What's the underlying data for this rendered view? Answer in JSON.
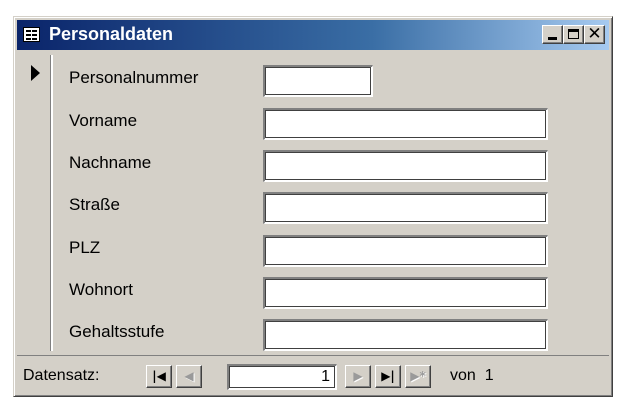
{
  "window": {
    "title": "Personaldaten",
    "close_glyph": "✕"
  },
  "fields": [
    {
      "label": "Personalnummer",
      "value": ""
    },
    {
      "label": "Vorname",
      "value": ""
    },
    {
      "label": "Nachname",
      "value": ""
    },
    {
      "label": "Straße",
      "value": ""
    },
    {
      "label": "PLZ",
      "value": ""
    },
    {
      "label": "Wohnort",
      "value": ""
    },
    {
      "label": "Gehaltsstufe",
      "value": ""
    }
  ],
  "navigation": {
    "label": "Datensatz:",
    "current_record": "1",
    "of_text": "von  1",
    "first_glyph": "|◀",
    "prev_glyph": "◀",
    "next_glyph": "▶",
    "last_glyph": "▶|",
    "new_glyph": "▶*"
  },
  "icons": {
    "form_icon": "form-icon",
    "record_selector": "current-record-arrow-icon"
  }
}
